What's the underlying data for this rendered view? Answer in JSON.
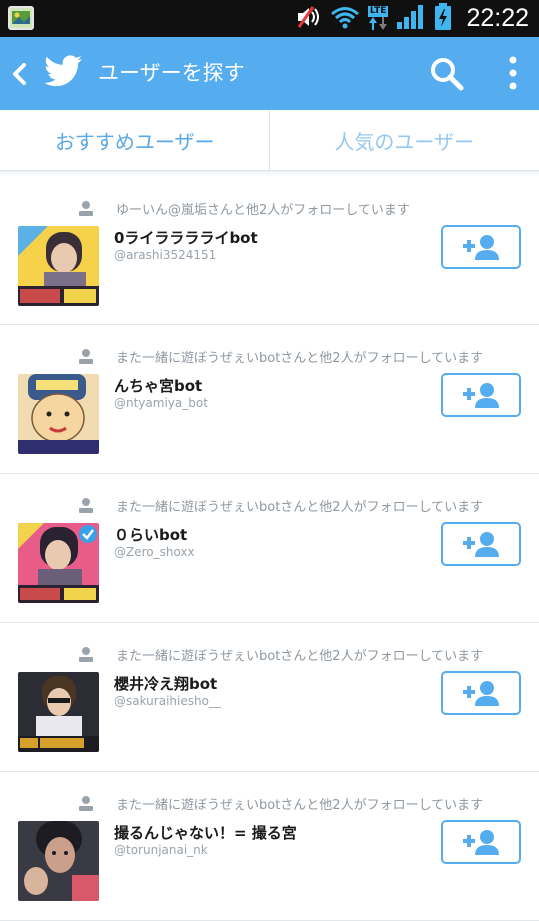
{
  "status_bar": {
    "time": "22:22",
    "network_label": "LTE",
    "icons": [
      "gallery-notification-icon",
      "mute-icon",
      "wifi-icon",
      "lte-icon",
      "signal-icon",
      "battery-charging-icon"
    ]
  },
  "app_bar": {
    "title": "ユーザーを探す",
    "color": "#55acee",
    "icons": [
      "back-arrow-icon",
      "twitter-bird-icon",
      "search-icon",
      "more-vert-icon"
    ]
  },
  "tabs": [
    {
      "label": "おすすめユーザー",
      "selected": true
    },
    {
      "label": "人気のユーザー",
      "selected": false
    }
  ],
  "users": [
    {
      "context": "ゆーいん@嵐垢さんと他2人がフォローしています",
      "name": "0ライラララライbot",
      "handle": "@arashi3524151",
      "avatar_colors": [
        "#f5d24a",
        "#7b6f8a",
        "#2b2430",
        "#c94a4a"
      ]
    },
    {
      "context": "また一緒に遊ぼうぜぇいbotさんと他2人がフォローしています",
      "name": "んちゃ宮bot",
      "handle": "@ntyamiya_bot",
      "avatar_colors": [
        "#f0dcb0",
        "#f6d6a0",
        "#3b5a8c",
        "#c43b3b"
      ]
    },
    {
      "context": "また一緒に遊ぼうぜぇいbotさんと他2人がフォローしています",
      "name": "０らいbot",
      "handle": "@Zero_shoxx",
      "avatar_colors": [
        "#e85c8a",
        "#6a5e7a",
        "#2a2230",
        "#f2d34c"
      ]
    },
    {
      "context": "また一緒に遊ぼうぜぇいbotさんと他2人がフォローしています",
      "name": "櫻井冷え翔bot",
      "handle": "@sakuraihiesho__",
      "avatar_colors": [
        "#2c2c34",
        "#e8e8ee",
        "#6b4a2e",
        "#d6a12a"
      ]
    },
    {
      "context": "また一緒に遊ぼうぜぇいbotさんと他2人がフォローしています",
      "name": "撮るんじゃない！= 撮る宮",
      "handle": "@torunjanai_nk",
      "avatar_colors": [
        "#1c1c22",
        "#caa08a",
        "#3a3a44",
        "#d85a6a"
      ]
    }
  ],
  "follow_button_icon": "add-user-icon",
  "accent_color": "#55acee"
}
